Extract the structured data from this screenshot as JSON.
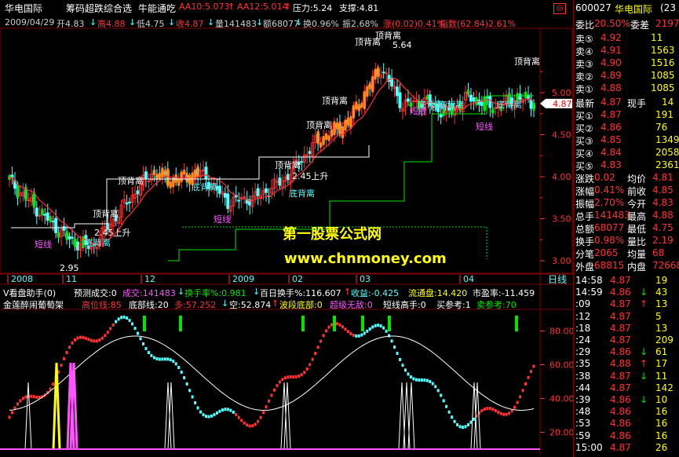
{
  "header": {
    "stock_name": "华电国际",
    "indicator_name": "筹码超跌综合选",
    "indicator_name2": "牛能通吃",
    "ma10": "AA10:5.073",
    "ma10_arrow": "↑",
    "ma12": "AA12:5.014",
    "ma12_arrow": "↑",
    "pressure": "压力:5.24",
    "support": "支撑:4.81",
    "close_button": "◎"
  },
  "infobar": {
    "date": "2009/04/29",
    "open": "开4.83",
    "open_arrow": "↓",
    "high": "高4.88",
    "high_arrow": "↓",
    "low": "低4.75",
    "low_arrow": "↓",
    "close": "收4.87",
    "close_arrow": "↓",
    "volume": "量141483",
    "volume_arrow": "↓",
    "amount": "额68077",
    "amount_arrow": "↓",
    "turnover": "换0.96%",
    "amplitude": "振2.68%",
    "change": "涨(0.02)0.41%",
    "index": "指数(62.84)2.61%"
  },
  "price_axis": {
    "labels": [
      "5.00",
      "4.50",
      "4.00",
      "3.50",
      "3.00"
    ],
    "current_price_tag": "4.87"
  },
  "date_axis": {
    "labels": [
      "2008",
      "11",
      "12",
      "2009",
      "02",
      "03",
      "04"
    ],
    "period": "日线"
  },
  "chart_annotations": {
    "top_labels": [
      "顶背离",
      "顶背离",
      "顶背离",
      "顶背离",
      "顶背离",
      "顶背离",
      "顶背离",
      "顶背离"
    ],
    "bottom_labels": [
      "底背离",
      "底背离",
      "底背离",
      "底背离",
      "底背离",
      "底背离",
      "底背离"
    ],
    "short_labels": [
      "短线",
      "短线",
      "短线",
      "短线"
    ],
    "rise_labels": [
      "2.45上升",
      "2.45上升"
    ],
    "high_point": "5.64",
    "low_point": "2.95"
  },
  "watermark": {
    "line1": "第一股票公式网",
    "line2": "www.chnmoney.com"
  },
  "subchart_header": {
    "name": "V看盘助手(0)",
    "predicted_volume": "预测成交:0",
    "volume": "成交:141483",
    "volume_arrow": "↓",
    "turnover_rate": "换手率%:0.981",
    "turnover_arrow": "↓",
    "hundred_day": "百日换手%:116.607",
    "hundred_arrow": "↑",
    "profit": "收益:-0.425",
    "circulation": "流通盘:14.420",
    "pe": "市盈率:-11.459"
  },
  "subchart2_header": {
    "name": "金莲醉闹葡萄架",
    "high_line": "高位线:85",
    "bottom_line": "底部线:20",
    "long": "多:57.252",
    "long_arrow": "↓",
    "short": "空:52.874",
    "short_arrow": "↑",
    "wave_bottom": "波段底部:0",
    "super_bottom": "超级无敌:0",
    "short_master": "短线高手:0",
    "buy_ref": "买参考:1",
    "sell_ref": "卖参考:70"
  },
  "sub_axis": {
    "labels": [
      "80.00",
      "60.00",
      "40.00",
      "20.00"
    ]
  },
  "right_panel": {
    "code": "600027",
    "name": "华电国际",
    "name_suffix": "(23",
    "ratio_label": "委比",
    "ratio_value": "20.50%",
    "diff_label": "委差",
    "diff_value": "2197",
    "asks": [
      {
        "label": "卖⑤",
        "price": "4.92",
        "vol": "11"
      },
      {
        "label": "卖④",
        "price": "4.91",
        "vol": "1563"
      },
      {
        "label": "卖③",
        "price": "4.90",
        "vol": "1516"
      },
      {
        "label": "卖②",
        "price": "4.89",
        "vol": "1085"
      },
      {
        "label": "卖①",
        "price": "4.88",
        "vol": "1085"
      }
    ],
    "last_label": "最新",
    "last_price": "4.87",
    "last_extra_label": "现手",
    "last_extra_value": "14",
    "bids": [
      {
        "label": "买①",
        "price": "4.87",
        "vol": "191"
      },
      {
        "label": "买②",
        "price": "4.86",
        "vol": "76"
      },
      {
        "label": "买③",
        "price": "4.85",
        "vol": "1349"
      },
      {
        "label": "买④",
        "price": "4.84",
        "vol": "2058"
      },
      {
        "label": "买⑤",
        "price": "4.83",
        "vol": "2361"
      }
    ],
    "stats": [
      {
        "l1": "涨跌",
        "v1": "0.02",
        "l2": "均价",
        "v2": "4.81"
      },
      {
        "l1": "涨幅",
        "v1": "0.41%",
        "l2": "前收",
        "v2": "4.85"
      },
      {
        "l1": "振幅",
        "v1": "2.70%",
        "l2": "今开",
        "v2": "4.83"
      },
      {
        "l1": "总手",
        "v1": "141483",
        "l2": "最高",
        "v2": "4.88"
      },
      {
        "l1": "总额",
        "v1": "68077",
        "l2": "最低",
        "v2": "4.75"
      },
      {
        "l1": "换手",
        "v1": "0.98%",
        "l2": "量比",
        "v2": "2.19"
      },
      {
        "l1": "分笔",
        "v1": "2065",
        "l2": "均量",
        "v2": "68"
      },
      {
        "l1": "外盘",
        "v1": "68815",
        "l2": "内盘",
        "v2": "72668"
      }
    ],
    "ticks": [
      {
        "time": "14:58",
        "price": "4.87",
        "vol": "19",
        "dir": ""
      },
      {
        "time": "14:59",
        "price": "4.86",
        "vol": "43",
        "dir": "↓"
      },
      {
        "time": ":09",
        "price": "4.87",
        "vol": "13",
        "dir": "↑"
      },
      {
        "time": ":12",
        "price": "4.87",
        "vol": "5",
        "dir": ""
      },
      {
        "time": ":18",
        "price": "4.87",
        "vol": "13",
        "dir": ""
      },
      {
        "time": ":24",
        "price": "4.87",
        "vol": "209",
        "dir": ""
      },
      {
        "time": ":29",
        "price": "4.86",
        "vol": "61",
        "dir": "↓"
      },
      {
        "time": ":35",
        "price": "4.88",
        "vol": "17",
        "dir": "↑"
      },
      {
        "time": ":38",
        "price": "4.87",
        "vol": "11",
        "dir": "↓"
      },
      {
        "time": ":44",
        "price": "4.87",
        "vol": "142",
        "dir": ""
      },
      {
        "time": ":39",
        "price": "4.86",
        "vol": "10",
        "dir": "↓"
      },
      {
        "time": ":48",
        "price": "4.86",
        "vol": "16",
        "dir": ""
      },
      {
        "time": ":53",
        "price": "4.86",
        "vol": "16",
        "dir": ""
      },
      {
        "time": ":59",
        "price": "4.86",
        "vol": "16",
        "dir": ""
      },
      {
        "time": "15:00",
        "price": "4.87",
        "vol": "26",
        "dir": ""
      }
    ]
  },
  "colors": {
    "up": "#ff3232",
    "down": "#54ffff",
    "yellow": "#ffff00",
    "green": "#00e600",
    "magenta": "#ff54ff",
    "orange": "#ff8c1a",
    "white": "#ffffff",
    "grid": "#800000"
  }
}
